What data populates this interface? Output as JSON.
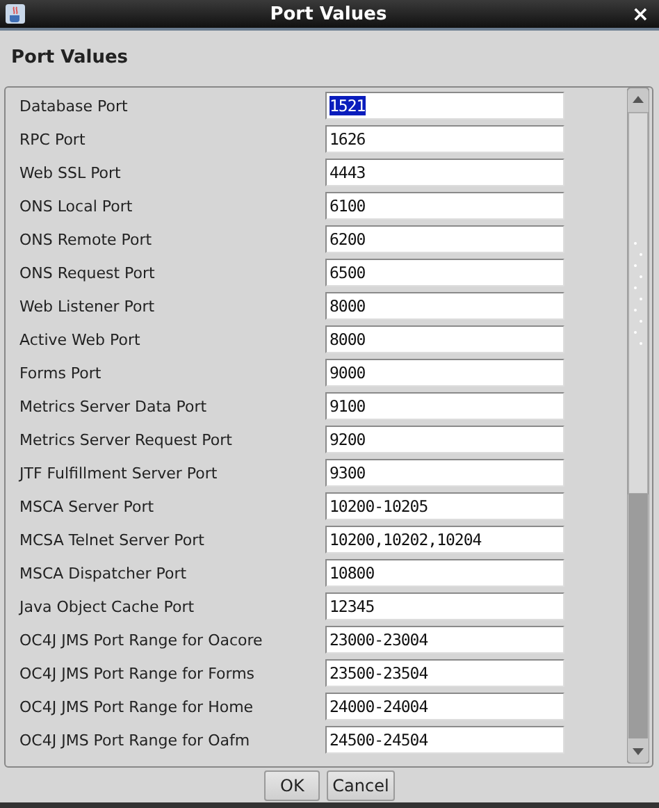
{
  "window": {
    "title": "Port Values",
    "close": "×"
  },
  "heading": "Port Values",
  "ports": [
    {
      "label": "Database Port",
      "value": "1521",
      "text_selected": true
    },
    {
      "label": "RPC Port",
      "value": "1626",
      "text_selected": false
    },
    {
      "label": "Web SSL Port",
      "value": "4443",
      "text_selected": false
    },
    {
      "label": "ONS Local Port",
      "value": "6100",
      "text_selected": false
    },
    {
      "label": "ONS Remote Port",
      "value": "6200",
      "text_selected": false
    },
    {
      "label": "ONS Request Port",
      "value": "6500",
      "text_selected": false
    },
    {
      "label": "Web Listener Port",
      "value": "8000",
      "text_selected": false
    },
    {
      "label": "Active Web Port",
      "value": "8000",
      "text_selected": false
    },
    {
      "label": "Forms Port",
      "value": "9000",
      "text_selected": false
    },
    {
      "label": "Metrics Server Data Port",
      "value": "9100",
      "text_selected": false
    },
    {
      "label": "Metrics Server Request Port",
      "value": "9200",
      "text_selected": false
    },
    {
      "label": "JTF Fulfillment Server Port",
      "value": "9300",
      "text_selected": false
    },
    {
      "label": "MSCA Server Port",
      "value": "10200-10205",
      "text_selected": false
    },
    {
      "label": "MCSA Telnet Server Port",
      "value": "10200,10202,10204",
      "text_selected": false
    },
    {
      "label": "MSCA Dispatcher Port",
      "value": "10800",
      "text_selected": false
    },
    {
      "label": "Java Object Cache Port",
      "value": "12345",
      "text_selected": false
    },
    {
      "label": "OC4J JMS Port Range for Oacore",
      "value": "23000-23004",
      "text_selected": false
    },
    {
      "label": "OC4J JMS Port Range for Forms",
      "value": "23500-23504",
      "text_selected": false
    },
    {
      "label": "OC4J JMS Port Range for Home",
      "value": "24000-24004",
      "text_selected": false
    },
    {
      "label": "OC4J JMS Port Range for Oafm",
      "value": "24500-24504",
      "text_selected": false
    }
  ],
  "buttons": [
    {
      "label": "OK"
    },
    {
      "label": "Cancel"
    }
  ]
}
